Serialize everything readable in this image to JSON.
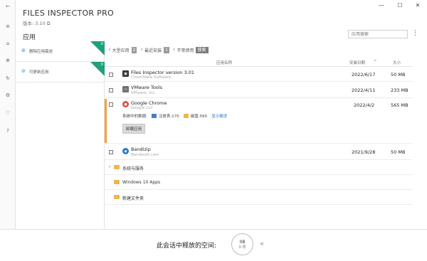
{
  "window": {
    "minimize": "—",
    "maximize": "☐",
    "close": "✕"
  },
  "app": {
    "title": "FILES INSPECTOR PRO",
    "version": "版本: 3.10 ⧉"
  },
  "rail_icons": [
    {
      "name": "back-icon",
      "glyph": "←"
    },
    {
      "name": "menu-icon",
      "glyph": "≡"
    },
    {
      "name": "bell-icon",
      "glyph": "⌂"
    },
    {
      "name": "target-icon",
      "glyph": "⊕"
    },
    {
      "name": "refresh-icon",
      "glyph": "↻"
    },
    {
      "name": "gear-icon",
      "glyph": "⚙"
    },
    {
      "name": "thumbs-up-icon",
      "glyph": "♡"
    },
    {
      "name": "help-icon",
      "glyph": "?"
    }
  ],
  "section": {
    "title": "应用"
  },
  "search": {
    "placeholder": "应用搜索"
  },
  "left_panel": [
    {
      "label": "删除应用痕迹",
      "badge": "0",
      "icon": "⊛"
    },
    {
      "label": "可更新应用",
      "badge": "0",
      "icon": "⊘"
    }
  ],
  "filters": {
    "f1_label": "大型应用",
    "f1_count": "2",
    "f2_label": "最近安装",
    "f2_count": "1",
    "f3_label": "不常使用",
    "search_btn": "搜索"
  },
  "table": {
    "col_name": "应用名称",
    "col_date": "安装日期",
    "col_date_sort": "^",
    "col_size": "大小"
  },
  "apps": [
    {
      "name": "Files Inspector version 3.01",
      "publisher": "ChemTable Software",
      "date": "2022/6/17",
      "size": "50 MB",
      "color": "#333333",
      "glyph": "▣"
    },
    {
      "name": "VMware Tools",
      "publisher": "VMware, Inc.",
      "date": "2022/4/11",
      "size": "233 MB",
      "color": "#707070",
      "glyph": "▭"
    },
    {
      "name": "Google Chrome",
      "publisher": "Google LLC",
      "date": "2022/4/2",
      "size": "565 MB",
      "color": "#dd4b39",
      "glyph": "●"
    },
    {
      "name": "Bandizip",
      "publisher": "Bandisoft.com",
      "date": "2021/9/28",
      "size": "50 MB",
      "color": "#2c79c8",
      "glyph": "◆"
    }
  ],
  "selected_details": {
    "prefix": "系统中的数据:",
    "registry": "注册表:170",
    "disk": "磁盘:560",
    "show_more": "显示概述",
    "uninstall": "卸载应用"
  },
  "folders": [
    {
      "name": "系统与服务",
      "expandable": true
    },
    {
      "name": "Windows 10 Apps",
      "expandable": false
    },
    {
      "name": "新建文件夹",
      "expandable": false
    }
  ],
  "footer": {
    "freed_label": "此会话中释放的空间:",
    "gauge_value": "0B",
    "gauge_unit": "0 项",
    "share_icon": "<"
  },
  "colors": {
    "accent_green": "#1fa07a",
    "selected_bar": "#f2a33a",
    "link": "#2c79c8"
  }
}
